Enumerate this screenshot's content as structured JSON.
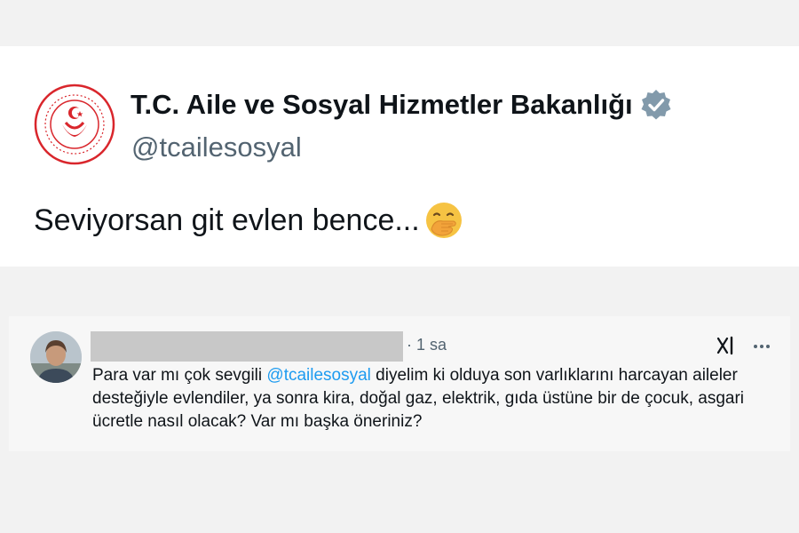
{
  "tweet": {
    "display_name": "T.C. Aile ve Sosyal Hizmetler Bakanlığı",
    "handle": "@tcailesosyal",
    "text": "Seviyorsan git evlen bence...",
    "emoji": "face-with-hand-over-mouth-emoji",
    "verified_badge_color": "#829aab",
    "logo_color": "#d9262c"
  },
  "reply": {
    "time": "· 1 sa",
    "text_before": "Para var mı çok sevgili ",
    "mention": "@tcailesosyal",
    "text_after": " diyelim ki olduya son varlıklarını harcayan aileler desteğiyle evlendiler, ya sonra kira, doğal gaz, elektrik, gıda üstüne bir de çocuk, asgari ücretle nasıl olacak? Var mı başka öneriniz?",
    "mention_color": "#1d9bf0",
    "icons": [
      "grok-icon",
      "more-icon"
    ]
  }
}
